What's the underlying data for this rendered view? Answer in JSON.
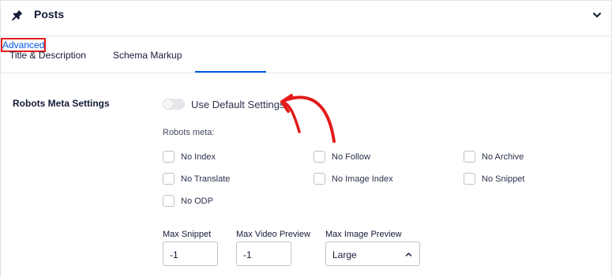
{
  "header": {
    "title": "Posts",
    "icon": "pin-icon",
    "collapse_icon": "chevron-down-icon"
  },
  "tabs": [
    {
      "label": "Title & Description",
      "active": false
    },
    {
      "label": "Schema Markup",
      "active": false
    },
    {
      "label": "Advanced",
      "active": true
    }
  ],
  "robots": {
    "section_label": "Robots Meta Settings",
    "toggle_label": "Use Default Settings",
    "toggle_on": false,
    "meta_label": "Robots meta:",
    "checkboxes": [
      {
        "label": "No Index",
        "checked": false
      },
      {
        "label": "No Follow",
        "checked": false
      },
      {
        "label": "No Archive",
        "checked": false
      },
      {
        "label": "No Translate",
        "checked": false
      },
      {
        "label": "No Image Index",
        "checked": false
      },
      {
        "label": "No Snippet",
        "checked": false
      },
      {
        "label": "No ODP",
        "checked": false
      }
    ],
    "fields": {
      "max_snippet": {
        "label": "Max Snippet",
        "value": "-1"
      },
      "max_video_preview": {
        "label": "Max Video Preview",
        "value": "-1"
      },
      "max_image_preview": {
        "label": "Max Image Preview",
        "value": "Large"
      }
    }
  },
  "colors": {
    "accent": "#005ae0",
    "highlight": "#e21b1b",
    "text": "#141b38"
  }
}
